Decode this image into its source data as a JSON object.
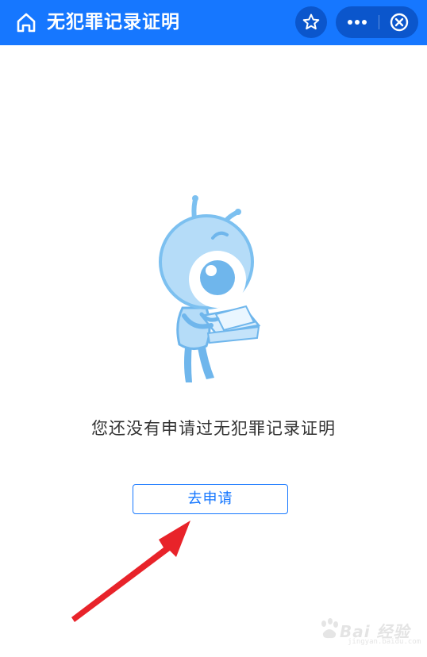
{
  "header": {
    "title": "无犯罪记录证明",
    "home_icon": "home-icon",
    "favorite_icon": "star-icon",
    "more_icon": "more-dots-icon",
    "close_icon": "close-circle-icon",
    "background_color": "#1677ff"
  },
  "main": {
    "illustration": "ant-mascot-holding-box",
    "empty_message": "您还没有申请过无犯罪记录证明",
    "apply_button_label": "去申请",
    "accent_color": "#1677ff"
  },
  "annotation": {
    "arrow_icon": "red-arrow-icon",
    "color": "#e8232a"
  },
  "watermark": {
    "text": "Bai 经验",
    "sub": "jingyan.baidu.com"
  }
}
